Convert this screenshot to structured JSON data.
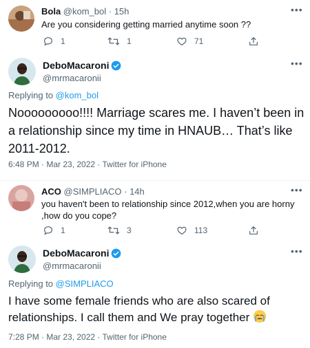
{
  "thread1": {
    "reply": {
      "name": "Bola",
      "handle": "@kom_bol",
      "time": "· 15h",
      "text": "Are you considering getting married anytime soon ??",
      "replies": "1",
      "retweets": "1",
      "likes": "71"
    },
    "main": {
      "name": "DeboMacaroni",
      "handle": "@mrmacaronii",
      "replying_label": "Replying to",
      "replying_to": "@kom_bol",
      "text": "Nooooooooo!!!! Marriage scares me. I haven’t been in a relationship since my time in HNAUB… That’s like 2011-2012.",
      "timestamp": "6:48 PM · Mar 23, 2022 · Twitter for iPhone"
    }
  },
  "thread2": {
    "reply": {
      "name": "ACO",
      "handle": "@SIMPLIACO",
      "time": "· 14h",
      "text": "you haven't been to relationship since 2012,when you are horny ,how do you cope?",
      "replies": "1",
      "retweets": "3",
      "likes": "113"
    },
    "main": {
      "name": "DeboMacaroni",
      "handle": "@mrmacaronii",
      "replying_label": "Replying to",
      "replying_to": "@SIMPLIACO",
      "text": "I have some female friends who are also scared of relationships. I call them and We pray together",
      "timestamp": "7:28 PM · Mar 23, 2022 · Twitter for iPhone"
    }
  },
  "icons": {
    "more": "more-icon",
    "reply": "reply-icon",
    "retweet": "retweet-icon",
    "like": "like-icon",
    "share": "share-icon",
    "verified": "verified-badge-icon",
    "emoji": "crying-face-emoji"
  },
  "colors": {
    "accent": "#1d9bf0",
    "text": "#0f1419",
    "muted": "#536471"
  }
}
